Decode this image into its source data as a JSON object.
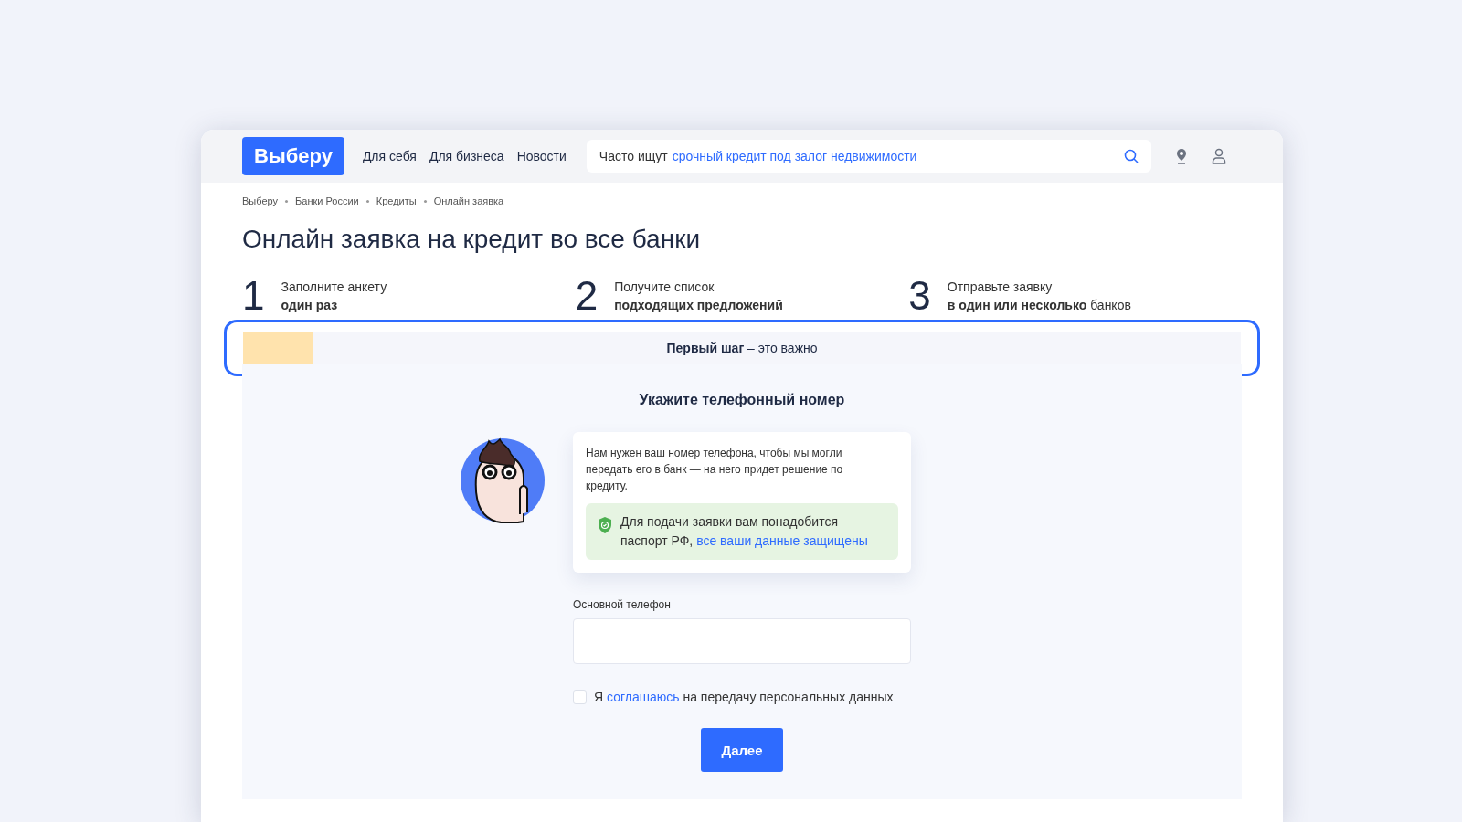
{
  "header": {
    "logo": "Выберу",
    "nav": [
      {
        "label": "Для себя"
      },
      {
        "label": "Для бизнеса"
      },
      {
        "label": "Новости"
      }
    ],
    "search": {
      "prefix": "Часто ищут",
      "suggestion": "срочный кредит под залог недвижимости"
    }
  },
  "breadcrumbs": [
    "Выберу",
    "Банки России",
    "Кредиты",
    "Онлайн заявка"
  ],
  "title": "Онлайн заявка на кредит во все банки",
  "steps": [
    {
      "number": "1",
      "line1": "Заполните анкету",
      "line2": "**один раз**"
    },
    {
      "number": "2",
      "line1": "Получите список",
      "line2": "**подходящих предложений**"
    },
    {
      "number": "3",
      "line1": "Отправьте заявку",
      "line2": "**в один или несколько** банков"
    }
  ],
  "progress": {
    "level": 0.07,
    "label": "**Первый шаг** – это важно",
    "highlighted": true
  },
  "form": {
    "heading": "Укажите телефонный номер",
    "message": "Нам нужен ваш номер телефона, чтобы мы могли передать его в банк — на него придет решение по кредиту.",
    "notice": {
      "text": "Для подачи заявки вам понадобится паспорт РФ,",
      "link": "все ваши данные защищены"
    },
    "phone_label": "Основной телефон",
    "consent": {
      "prefix": "Я",
      "link": "соглашаюсь",
      "suffix": "на передачу персональных данных",
      "checked": false
    },
    "button": "Далее"
  }
}
